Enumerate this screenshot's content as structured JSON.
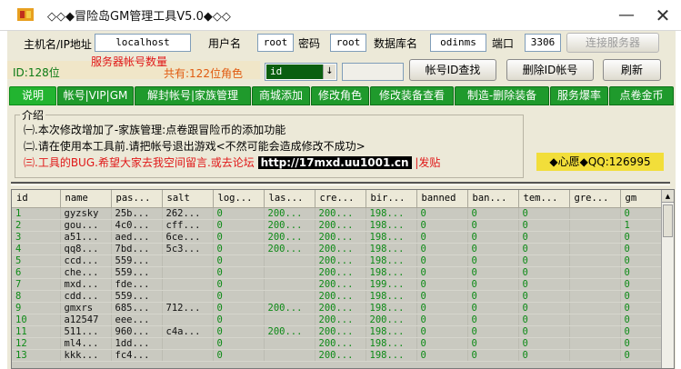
{
  "window": {
    "title": "◇◇◆冒险岛GM管理工具V5.0◆◇◇",
    "min_glyph": "—",
    "close_glyph": "✕"
  },
  "connection": {
    "host_label": "主机名/IP地址",
    "host_value": "localhost",
    "user_label": "用户名",
    "user_value": "root",
    "pass_label": "密码",
    "pass_value": "root",
    "db_label": "数据库名",
    "db_value": "odinms",
    "port_label": "端口",
    "port_value": "3306",
    "connect_button": "连接服务器"
  },
  "status": {
    "id_text": "ID:128位",
    "account_count_label": "服务器帐号数量",
    "role_count": "共有:122位角色"
  },
  "search": {
    "field_value": "id",
    "lookup_button": "帐号ID查找",
    "delete_button": "删除ID帐号",
    "refresh_button": "刷新"
  },
  "tabs": [
    "说明",
    "帐号|VIP|GM",
    "解封帐号|家族管理",
    "商城添加",
    "修改角色",
    "修改装备查看",
    "制造-删除装备",
    "服务爆率",
    "点卷金币"
  ],
  "intro": {
    "title": "介绍",
    "line1": "㈠.本次修改增加了-家族管理:点卷跟冒险币的添加功能",
    "line2": "㈡.请在使用本工具前.请把帐号退出游戏<不然可能会造成修改不成功>",
    "line3_prefix": "㈢.工具的BUG.希望大家去我空间留言.或去论坛",
    "line3_url": "http://17mxd.uu1001.cn",
    "line3_suffix": "|发贴",
    "qq": "◆心愿◆QQ:126995"
  },
  "table": {
    "columns": [
      "id",
      "name",
      "pas...",
      "salt",
      "log...",
      "las...",
      "cre...",
      "bir...",
      "banned",
      "ban...",
      "tem...",
      "gre...",
      "gm"
    ],
    "rows": [
      [
        "1",
        "gyzsky",
        "25b...",
        "262...",
        "0",
        "200...",
        "200...",
        "198...",
        "0",
        "0",
        "0",
        "",
        "0"
      ],
      [
        "2",
        "gou...",
        "4c0...",
        "cff...",
        "0",
        "200...",
        "200...",
        "198...",
        "0",
        "0",
        "0",
        "",
        "1"
      ],
      [
        "3",
        "a51...",
        "aed...",
        "6ce...",
        "0",
        "200...",
        "200...",
        "198...",
        "0",
        "0",
        "0",
        "",
        "0"
      ],
      [
        "4",
        "qq8...",
        "7bd...",
        "5c3...",
        "0",
        "200...",
        "200...",
        "198...",
        "0",
        "0",
        "0",
        "",
        "0"
      ],
      [
        "5",
        "ccd...",
        "559...",
        "",
        "0",
        "",
        "200...",
        "198...",
        "0",
        "0",
        "0",
        "",
        "0"
      ],
      [
        "6",
        "che...",
        "559...",
        "",
        "0",
        "",
        "200...",
        "198...",
        "0",
        "0",
        "0",
        "",
        "0"
      ],
      [
        "7",
        "mxd...",
        "fde...",
        "",
        "0",
        "",
        "200...",
        "199...",
        "0",
        "0",
        "0",
        "",
        "0"
      ],
      [
        "8",
        "cdd...",
        "559...",
        "",
        "0",
        "",
        "200...",
        "198...",
        "0",
        "0",
        "0",
        "",
        "0"
      ],
      [
        "9",
        "gmxrs",
        "685...",
        "712...",
        "0",
        "200...",
        "200...",
        "198...",
        "0",
        "0",
        "0",
        "",
        "0"
      ],
      [
        "10",
        "a12547",
        "eee...",
        "",
        "0",
        "",
        "200...",
        "200...",
        "0",
        "0",
        "0",
        "",
        "0"
      ],
      [
        "11",
        "511...",
        "960...",
        "c4a...",
        "0",
        "200...",
        "200...",
        "198...",
        "0",
        "0",
        "0",
        "",
        "0"
      ],
      [
        "12",
        "ml4...",
        "1dd...",
        "",
        "0",
        "",
        "200...",
        "198...",
        "0",
        "0",
        "0",
        "",
        "0"
      ],
      [
        "13",
        "kkk...",
        "fc4...",
        "",
        "0",
        "",
        "200...",
        "198...",
        "0",
        "0",
        "0",
        "",
        "0"
      ]
    ]
  },
  "colors": {
    "tab_green": "#1f9a2c",
    "accent_red": "#e01818",
    "qq_yellow": "#f2de3a",
    "id_green": "#0d8a16"
  },
  "icons": {
    "app": "app-icon",
    "dropdown": "chevron-down-icon",
    "scroll_up": "scroll-up-icon"
  }
}
